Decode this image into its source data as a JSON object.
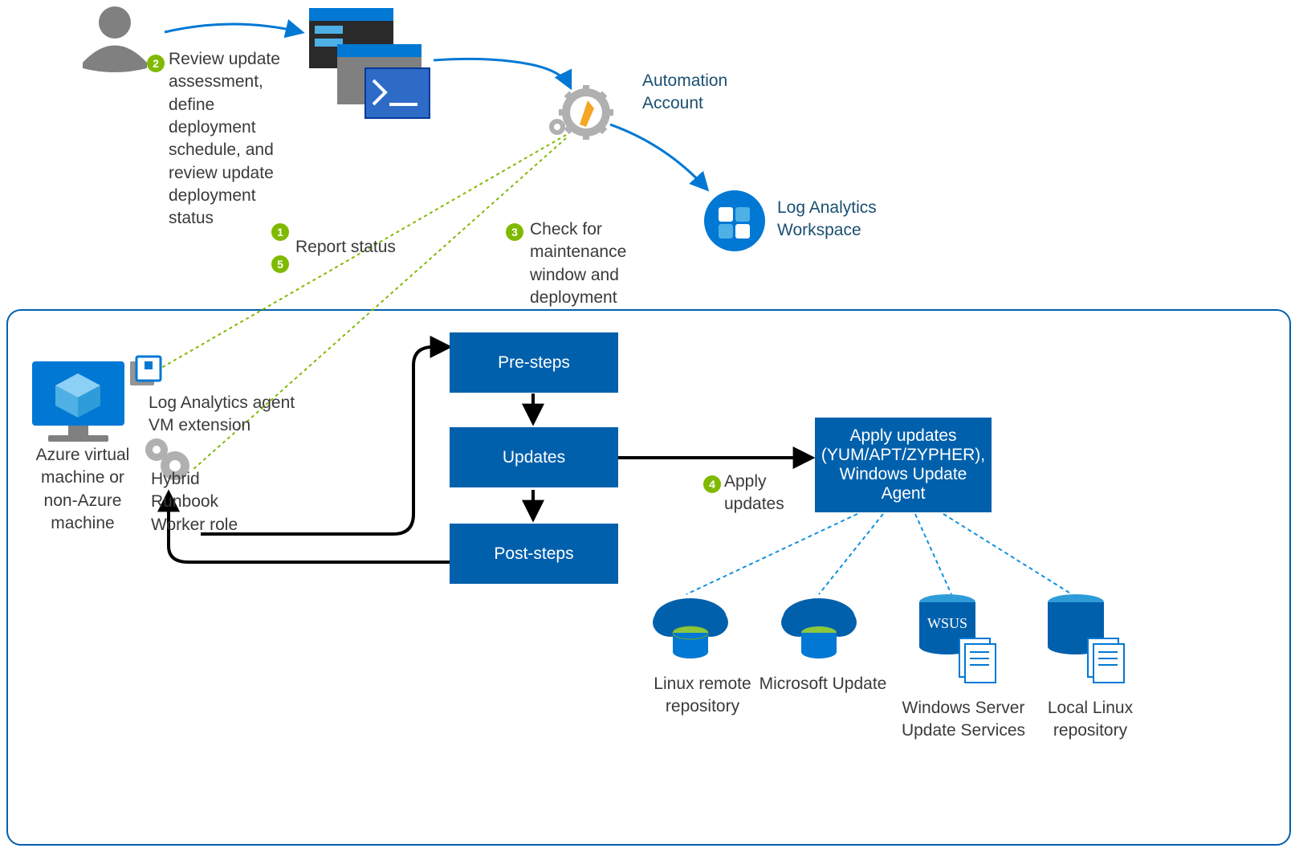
{
  "steps": {
    "s1": {
      "num": "1",
      "label": "Report status"
    },
    "s2": {
      "num": "2",
      "label": "Review update assessment, define deployment schedule, and review update deployment status"
    },
    "s3": {
      "num": "3",
      "label": "Check for maintenance window and deployment"
    },
    "s4": {
      "num": "4",
      "label": "Apply updates"
    },
    "s5": {
      "num": "5"
    }
  },
  "nodes": {
    "automation_account": "Automation Account",
    "law": "Log Analytics Workspace",
    "vm": "Azure virtual machine or non-Azure machine",
    "la_agent": "Log Analytics agent VM extension",
    "hrw": "Hybrid Runbook Worker role",
    "pre_steps": "Pre-steps",
    "updates": "Updates",
    "post_steps": "Post-steps",
    "apply_updates": "Apply updates (YUM/APT/ZYPHER), Windows Update Agent",
    "linux_remote": "Linux remote repository",
    "ms_update": "Microsoft Update",
    "wsus": "Windows Server Update Services",
    "wsus_short": "WSUS",
    "local_linux": "Local Linux repository"
  }
}
